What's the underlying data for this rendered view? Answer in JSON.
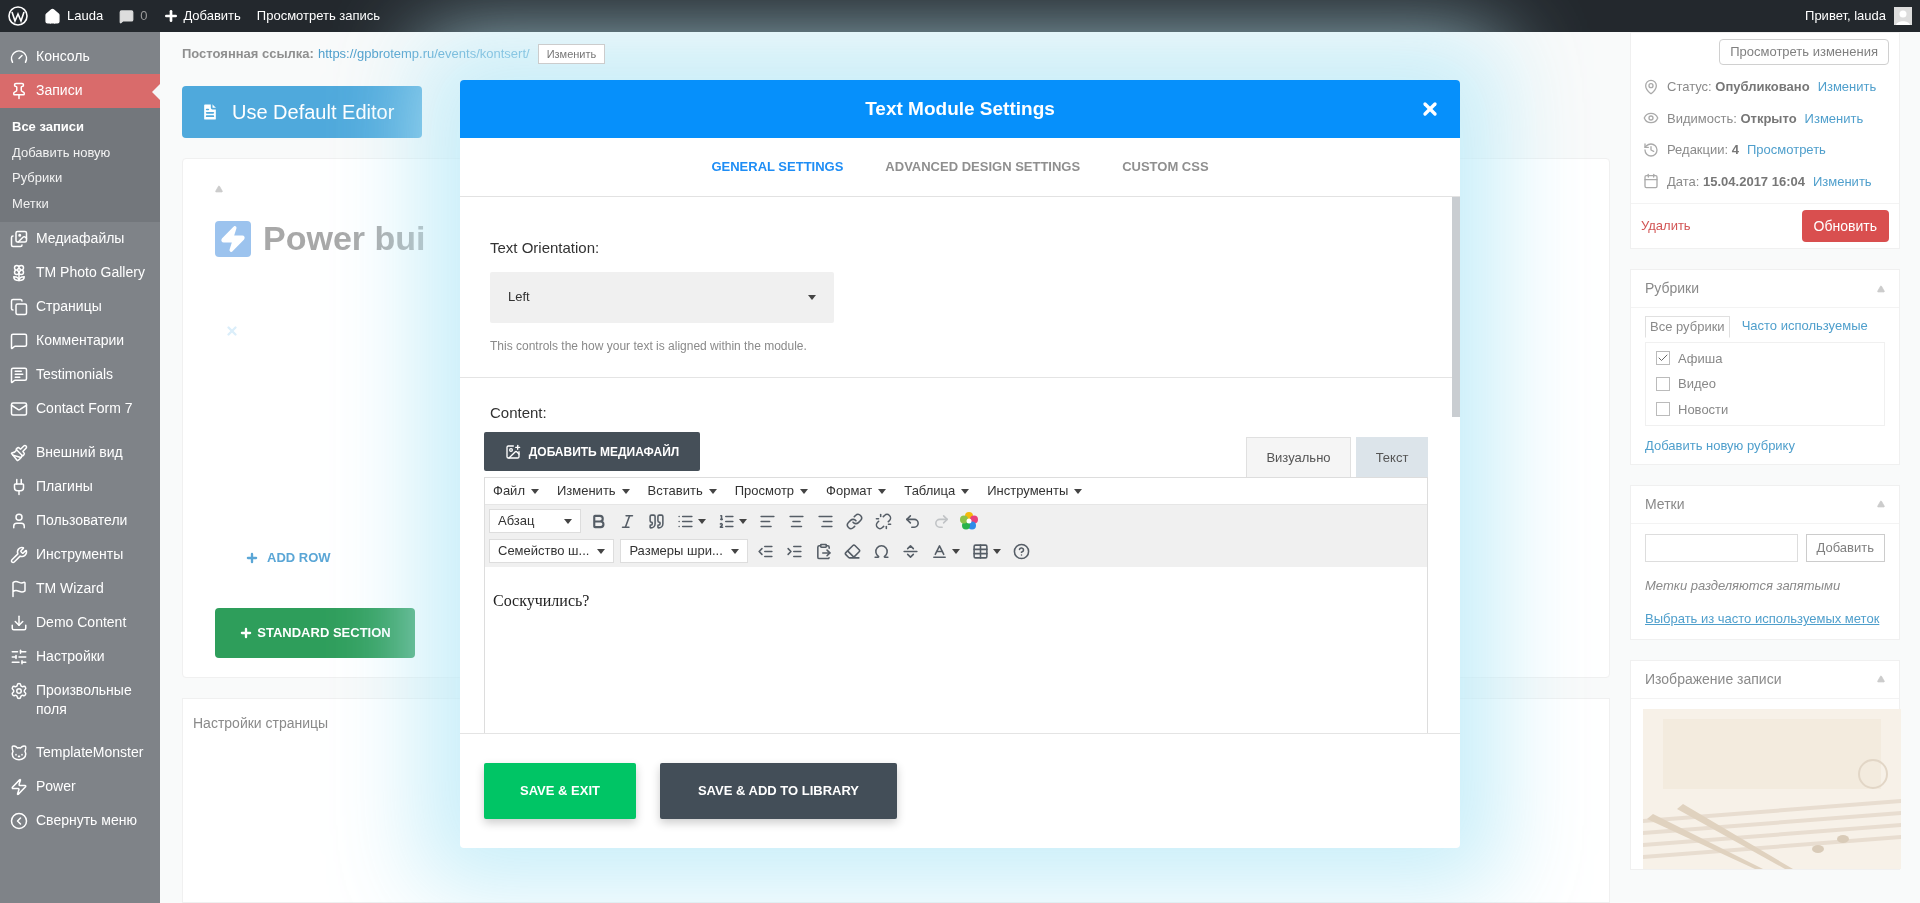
{
  "admin_bar": {
    "items": [
      {
        "kind": "logo"
      },
      {
        "kind": "home",
        "label": "Lauda"
      },
      {
        "kind": "comments",
        "label": "0"
      },
      {
        "kind": "add",
        "label": "Добавить"
      },
      {
        "kind": "text",
        "label": "Просмотреть запись"
      }
    ],
    "greeting": "Привет, lauda"
  },
  "sidebar": {
    "groups": [
      [
        {
          "label": "Консоль",
          "kind": "gauge",
          "selected": false
        },
        {
          "label": "Записи",
          "kind": "pin",
          "selected": true,
          "children": [
            {
              "label": "Все записи",
              "selected": true
            },
            {
              "label": "Добавить новую",
              "selected": false
            },
            {
              "label": "Рубрики",
              "selected": false
            },
            {
              "label": "Метки",
              "selected": false
            }
          ]
        },
        {
          "label": "Медиафайлы",
          "kind": "media",
          "selected": false
        },
        {
          "label": "TM Photo Gallery",
          "kind": "flower",
          "selected": false
        },
        {
          "label": "Страницы",
          "kind": "pages",
          "selected": false
        },
        {
          "label": "Комментарии",
          "kind": "comment",
          "selected": false
        },
        {
          "label": "Testimonials",
          "kind": "testimonial",
          "selected": false
        },
        {
          "label": "Contact Form 7",
          "kind": "mail",
          "selected": false
        }
      ],
      [
        {
          "label": "Внешний вид",
          "kind": "brush",
          "selected": false
        },
        {
          "label": "Плагины",
          "kind": "plug",
          "selected": false
        },
        {
          "label": "Пользователи",
          "kind": "user",
          "selected": false
        },
        {
          "label": "Инструменты",
          "kind": "wrench",
          "selected": false
        },
        {
          "label": "TM Wizard",
          "kind": "flag",
          "selected": false
        },
        {
          "label": "Demo Content",
          "kind": "download",
          "selected": false
        },
        {
          "label": "Настройки",
          "kind": "sliders",
          "selected": false
        },
        {
          "label": "Произвольные поля",
          "kind": "gear",
          "selected": false
        }
      ],
      [
        {
          "label": "TemplateMonster",
          "kind": "cat",
          "selected": false
        },
        {
          "label": "Power",
          "kind": "bolt",
          "selected": false
        },
        {
          "label": "Свернуть меню",
          "kind": "collapse",
          "selected": false
        }
      ]
    ]
  },
  "editor_page": {
    "permalink_label": "Постоянная ссылка:",
    "permalink_url": "https://gpbrotemp.ru/events/kontsert/",
    "permalink_button": "Изменить",
    "default_editor_button": "Use Default Editor",
    "builder_title": "Power bui",
    "add_row": "ADD ROW",
    "standard_section": "STANDARD SECTION",
    "page_settings": "Настройки страницы"
  },
  "publish_box": {
    "preview_button": "Просмотреть изменения",
    "rows": [
      {
        "kind": "status",
        "label": "Статус:",
        "value": "Опубликовано",
        "link": "Изменить"
      },
      {
        "kind": "visibility",
        "label": "Видимость:",
        "value": "Открыто",
        "link": "Изменить"
      },
      {
        "kind": "revisions",
        "label": "Редакции:",
        "value": "4",
        "link": "Просмотреть"
      },
      {
        "kind": "date",
        "label": "Дата:",
        "value": "15.04.2017 16:04",
        "link": "Изменить"
      }
    ],
    "delete": "Удалить",
    "update": "Обновить"
  },
  "categories_box": {
    "title": "Рубрики",
    "tabs": [
      {
        "label": "Все рубрики",
        "selected": true
      },
      {
        "label": "Часто используемые",
        "selected": false
      }
    ],
    "items": [
      {
        "label": "Афиша",
        "checked": true
      },
      {
        "label": "Видео",
        "checked": false
      },
      {
        "label": "Новости",
        "checked": false
      }
    ],
    "add_link": "Добавить новую рубрику"
  },
  "tags_box": {
    "title": "Метки",
    "add_button": "Добавить",
    "hint": "Метки разделяются запятыми",
    "choose_link": "Выбрать из часто используемых меток"
  },
  "featured_image_box": {
    "title": "Изображение записи"
  },
  "modal": {
    "title": "Text Module Settings",
    "tabs": [
      {
        "label": "GENERAL SETTINGS",
        "selected": true
      },
      {
        "label": "ADVANCED DESIGN SETTINGS",
        "selected": false
      },
      {
        "label": "CUSTOM CSS",
        "selected": false
      }
    ],
    "orientation": {
      "label": "Text Orientation:",
      "value": "Left",
      "help": "This controls the how your text is aligned within the module."
    },
    "content": {
      "label": "Content:",
      "media_button": "ДОБАВИТЬ МЕДИАФАЙЛ",
      "editor_tabs": [
        {
          "label": "Визуально",
          "selected": true
        },
        {
          "label": "Текст",
          "selected": false
        }
      ],
      "menu": [
        "Файл",
        "Изменить",
        "Вставить",
        "Просмотр",
        "Формат",
        "Таблица",
        "Инструменты"
      ],
      "toolbar_rows": [
        [
          {
            "kind": "select",
            "value": "Абзац"
          },
          {
            "kind": "bold",
            "disabled": false
          },
          {
            "kind": "italic",
            "disabled": false
          },
          {
            "kind": "quote",
            "disabled": false
          },
          {
            "kind": "bullet-list",
            "disabled": false,
            "dropdown": true
          },
          {
            "kind": "numbered-list",
            "disabled": false,
            "dropdown": true
          },
          {
            "kind": "align-left",
            "disabled": false
          },
          {
            "kind": "align-center",
            "disabled": false
          },
          {
            "kind": "align-right",
            "disabled": false
          },
          {
            "kind": "link",
            "disabled": false
          },
          {
            "kind": "unlink",
            "disabled": false
          },
          {
            "kind": "undo",
            "disabled": false
          },
          {
            "kind": "redo",
            "disabled": true
          },
          {
            "kind": "flower",
            "disabled": false
          }
        ],
        [
          {
            "kind": "select",
            "value": "Семейство ш..."
          },
          {
            "kind": "select",
            "value": "Размеры шри..."
          },
          {
            "kind": "outdent",
            "disabled": false
          },
          {
            "kind": "indent",
            "disabled": false
          },
          {
            "kind": "paste",
            "disabled": false
          },
          {
            "kind": "eraser",
            "disabled": false
          },
          {
            "kind": "omega",
            "disabled": false
          },
          {
            "kind": "rule",
            "disabled": false
          },
          {
            "kind": "text-color",
            "disabled": false,
            "dropdown": true
          },
          {
            "kind": "table",
            "disabled": false,
            "dropdown": true
          },
          {
            "kind": "help",
            "disabled": false
          }
        ]
      ],
      "text": "Соскучились?"
    },
    "buttons": [
      {
        "kind": "primary",
        "label": "SAVE & EXIT"
      },
      {
        "kind": "secondary",
        "label": "SAVE & ADD TO LIBRARY"
      }
    ]
  }
}
